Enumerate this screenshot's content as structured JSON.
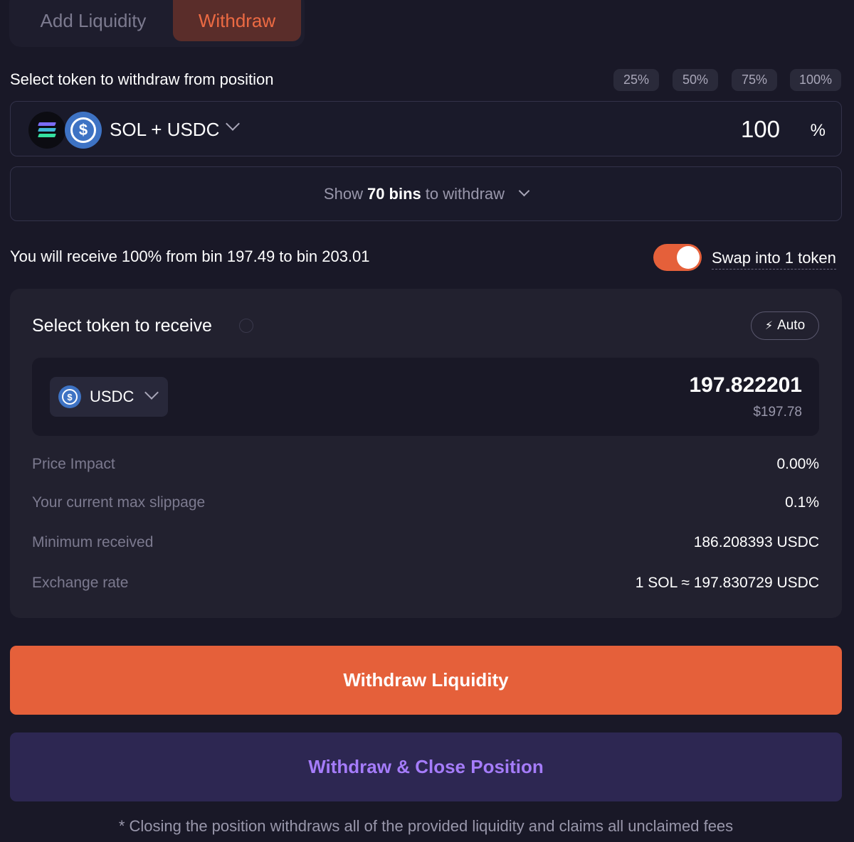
{
  "tabs": {
    "add_label": "Add Liquidity",
    "withdraw_label": "Withdraw"
  },
  "withdraw": {
    "section_label": "Select token to withdraw from position",
    "presets": [
      "25%",
      "50%",
      "75%",
      "100%"
    ],
    "pair_label": "SOL + USDC",
    "amount": "100",
    "amount_unit": "%",
    "bins_prefix": "Show",
    "bins_count": "70 bins",
    "bins_suffix": "to withdraw"
  },
  "receive_note": "You will receive 100% from bin 197.49 to bin 203.01",
  "swap": {
    "label": "Swap into 1 token",
    "enabled": true
  },
  "receive_card": {
    "title": "Select token to receive",
    "auto_label": "Auto",
    "token": "USDC",
    "amount": "197.822201",
    "usd_value": "$197.78",
    "rows": [
      {
        "label": "Price Impact",
        "value": "0.00%"
      },
      {
        "label": "Your current max slippage",
        "value": "0.1%"
      },
      {
        "label": "Minimum received",
        "value": "186.208393 USDC"
      },
      {
        "label": "Exchange rate",
        "value": "1 SOL ≈ 197.830729 USDC"
      }
    ]
  },
  "buttons": {
    "withdraw_label": "Withdraw Liquidity",
    "close_label": "Withdraw & Close Position"
  },
  "footnote": "* Closing the position withdraws all of the provided liquidity and claims all unclaimed fees",
  "colors": {
    "accent": "#e5603a",
    "purple": "#a57cfa",
    "bg": "#191827"
  }
}
